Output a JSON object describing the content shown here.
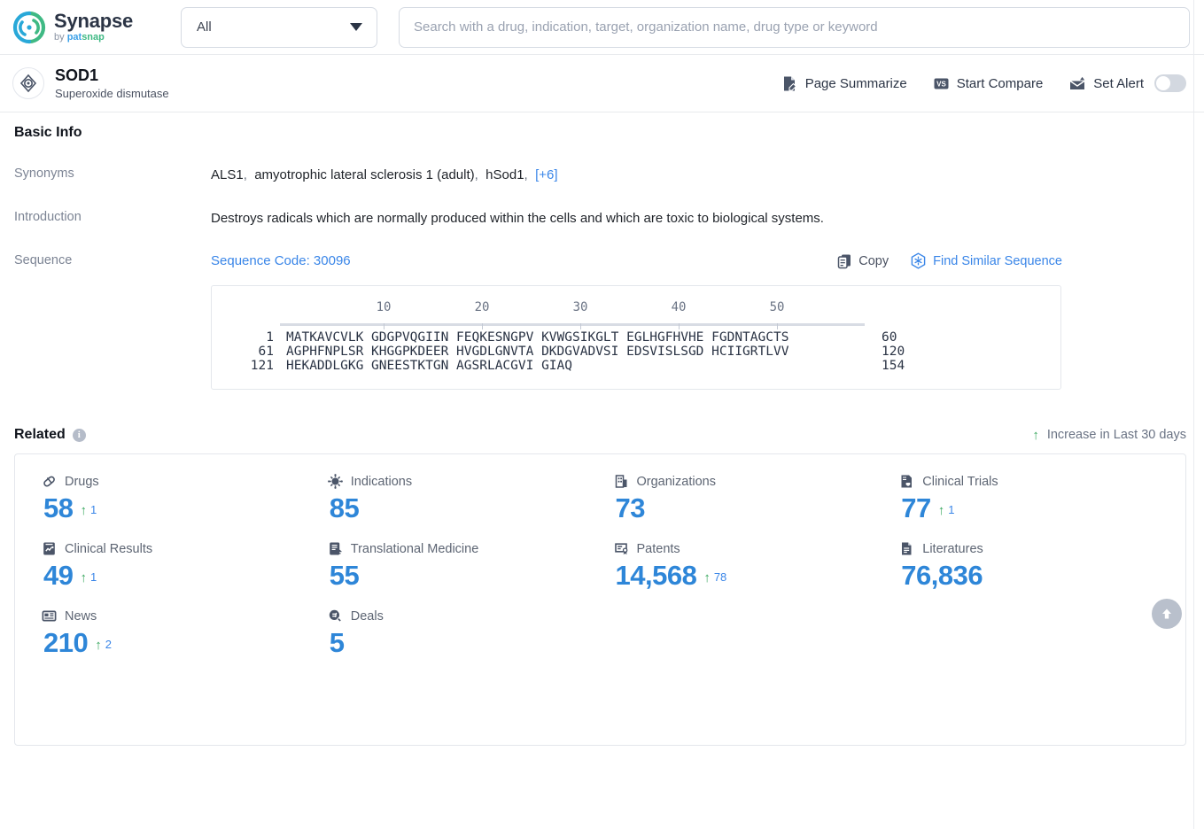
{
  "brand": {
    "name": "Synapse",
    "by": "by ",
    "pat": "pat",
    "snap": "snap"
  },
  "search": {
    "category_value": "All",
    "placeholder": "Search with a drug, indication, target, organization name, drug type or keyword",
    "value": ""
  },
  "entity": {
    "title": "SOD1",
    "subtitle": "Superoxide dismutase",
    "actions": {
      "page_summarize": "Page Summarize",
      "start_compare": "Start Compare",
      "set_alert": "Set Alert"
    }
  },
  "basic_info": {
    "heading": "Basic Info",
    "synonyms_label": "Synonyms",
    "synonyms": [
      "ALS1",
      "amyotrophic lateral sclerosis 1 (adult)",
      "hSod1"
    ],
    "synonyms_more": "[+6]",
    "introduction_label": "Introduction",
    "introduction": "Destroys radicals which are normally produced within the cells and which are toxic to biological systems.",
    "sequence_label": "Sequence",
    "sequence_code": "Sequence Code: 30096",
    "copy_label": "Copy",
    "find_similar_label": "Find Similar Sequence"
  },
  "sequence": {
    "ruler_ticks": [
      10,
      20,
      30,
      40,
      50
    ],
    "lines": [
      {
        "start": "1",
        "blocks": [
          "MATKAVCVLK",
          "GDGPVQGIIN",
          "FEQKESNGPV",
          "KVWGSIKGLT",
          "EGLHGFHVHE",
          "FGDNTAGCTS"
        ],
        "end": "60"
      },
      {
        "start": "61",
        "blocks": [
          "AGPHFNPLSR",
          "KHGGPKDEER",
          "HVGDLGNVTA",
          "DKDGVADVSI",
          "EDSVISLSGD",
          "HCIIGRTLVV"
        ],
        "end": "120"
      },
      {
        "start": "121",
        "blocks": [
          "HEKADDLGKG",
          "GNEESTKTGN",
          "AGSRLACGVI",
          "GIAQ"
        ],
        "end": "154"
      }
    ]
  },
  "related": {
    "heading": "Related",
    "increase_note": "Increase in Last 30 days",
    "metrics": [
      {
        "icon": "pill-icon",
        "label": "Drugs",
        "value": "58",
        "delta": "1"
      },
      {
        "icon": "virus-icon",
        "label": "Indications",
        "value": "85",
        "delta": ""
      },
      {
        "icon": "building-icon",
        "label": "Organizations",
        "value": "73",
        "delta": ""
      },
      {
        "icon": "clinical-trial-icon",
        "label": "Clinical Trials",
        "value": "77",
        "delta": "1"
      },
      {
        "icon": "clinical-result-icon",
        "label": "Clinical Results",
        "value": "49",
        "delta": "1"
      },
      {
        "icon": "translational-icon",
        "label": "Translational Medicine",
        "value": "55",
        "delta": ""
      },
      {
        "icon": "patent-icon",
        "label": "Patents",
        "value": "14,568",
        "delta": "78"
      },
      {
        "icon": "literature-icon",
        "label": "Literatures",
        "value": "76,836",
        "delta": ""
      },
      {
        "icon": "news-icon",
        "label": "News",
        "value": "210",
        "delta": "2"
      },
      {
        "icon": "deal-icon",
        "label": "Deals",
        "value": "5",
        "delta": ""
      }
    ]
  },
  "colors": {
    "accent_blue": "#2e86d8",
    "link_blue": "#3a86e8",
    "up_green": "#3aa860",
    "brand_dark": "#2b3445"
  }
}
